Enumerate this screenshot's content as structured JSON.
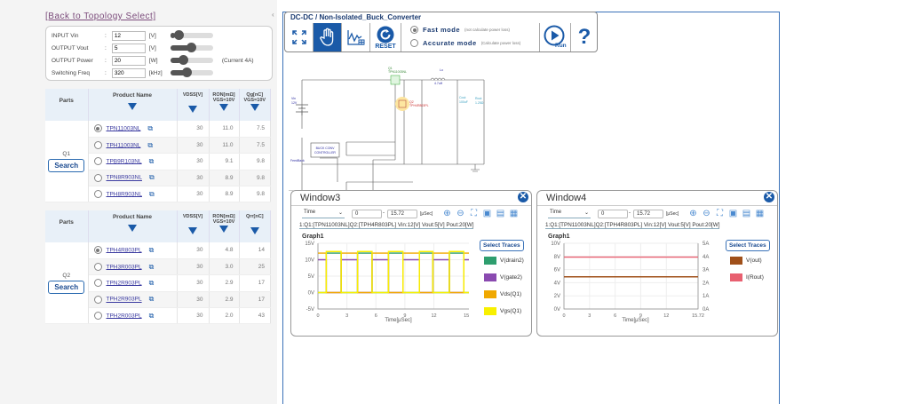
{
  "back_link": "[Back to Topology Select]",
  "params": [
    {
      "label": "INPUT Vin",
      "value": "12",
      "unit": "[V]",
      "slider": 0.1,
      "note": ""
    },
    {
      "label": "OUTPUT Vout",
      "value": "5",
      "unit": "[V]",
      "slider": 0.5,
      "note": ""
    },
    {
      "label": "OUTPUT Power",
      "value": "20",
      "unit": "[W]",
      "slider": 0.25,
      "note": "(Current 4A)"
    },
    {
      "label": "Switching Freq",
      "value": "320",
      "unit": "[kHz]",
      "slider": 0.35,
      "note": ""
    }
  ],
  "table_headers": {
    "parts": "Parts",
    "product": "Product Name",
    "vdss": "VDSS[V]",
    "ron": "RON[mΩ]",
    "ron_sub": "VGS=10V",
    "qg": "Qg[nC]",
    "qg_sub": "VGS=10V",
    "qrr": "Qrr[nC]"
  },
  "q1": {
    "label": "Q1",
    "search": "Search",
    "rows": [
      {
        "name": "TPN11003NL",
        "vdss": "30",
        "ron": "11.0",
        "q": "7.5",
        "selected": true
      },
      {
        "name": "TPH11003NL",
        "vdss": "30",
        "ron": "11.0",
        "q": "7.5",
        "selected": false
      },
      {
        "name": "TPB9R103NL",
        "vdss": "30",
        "ron": "9.1",
        "q": "9.8",
        "selected": false
      },
      {
        "name": "TPN8R903NL",
        "vdss": "30",
        "ron": "8.9",
        "q": "9.8",
        "selected": false
      },
      {
        "name": "TPH8R903NL",
        "vdss": "30",
        "ron": "8.9",
        "q": "9.8",
        "selected": false
      }
    ]
  },
  "q2": {
    "label": "Q2",
    "search": "Search",
    "rows": [
      {
        "name": "TPH4R803PL",
        "vdss": "30",
        "ron": "4.8",
        "q": "14",
        "selected": true
      },
      {
        "name": "TPH3R003PL",
        "vdss": "30",
        "ron": "3.0",
        "q": "25",
        "selected": false
      },
      {
        "name": "TPN2R903PL",
        "vdss": "30",
        "ron": "2.9",
        "q": "17",
        "selected": false
      },
      {
        "name": "TPH2R903PL",
        "vdss": "30",
        "ron": "2.9",
        "q": "17",
        "selected": false
      },
      {
        "name": "TPH2R003PL",
        "vdss": "30",
        "ron": "2.0",
        "q": "43",
        "selected": false
      }
    ]
  },
  "toolbar": {
    "title": "DC-DC / Non-Isolated_Buck_Converter",
    "reset": "RESET",
    "run": "Run",
    "help": "?",
    "fast_mode": "Fast mode",
    "fast_note": "(not calculate power loss)",
    "accurate_mode": "Accurate mode",
    "accurate_note": "(Calculate power loss)",
    "selected_mode": "fast"
  },
  "schematic": {
    "q1": "Q1",
    "q1_part": "TPN11003NL",
    "q2": "Q2",
    "q2_part": "TPH4R803PL",
    "lo": "Lo",
    "lo_val": "4.7uH",
    "cout": "Cout",
    "cout_val": "100uF",
    "rout": "Rout",
    "rout_val": "1.25Ω",
    "vin": "Vin",
    "vin_val": "12V",
    "ctrl1": "BUCK CONV",
    "ctrl2": "CONTROLLER",
    "fb": "FeedBack"
  },
  "windows": [
    {
      "title": "Window3",
      "axis": "Time",
      "from": "0",
      "to": "15.72",
      "unit": "[μSec]",
      "info": "1:Q1:[TPN11003NL]Q2:[TPH4R803PL] Vin:12[V]  Vout:5[V]  Pout:20[W]",
      "graph": "Graph1",
      "select": "Select Traces"
    },
    {
      "title": "Window4",
      "axis": "Time",
      "from": "0",
      "to": "15.72",
      "unit": "[μSec]",
      "info": "1:Q1:[TPN11003NL]Q2:[TPH4R803PL] Vin:12[V]  Vout:5[V]  Pout:20[W]",
      "graph": "Graph1",
      "select": "Select Traces"
    }
  ],
  "chart_data": [
    {
      "type": "line",
      "title": "Graph1",
      "xlabel": "Time[μSec]",
      "xlim": [
        0,
        15.72
      ],
      "xticks": [
        "0",
        "3",
        "6",
        "9",
        "12",
        "15.72"
      ],
      "ylim": [
        -5,
        15
      ],
      "yticks": [
        "15V",
        "10V",
        "5V",
        "0V",
        "-5V"
      ],
      "legend": "right",
      "series": [
        {
          "name": "V(drain2)",
          "color": "#2e9e6e",
          "high": 12,
          "low": 0,
          "high_intervals": [
            [
              0.86,
              2.4
            ],
            [
              4.1,
              5.6
            ],
            [
              7.3,
              8.8
            ],
            [
              10.5,
              11.9
            ],
            [
              13.6,
              15.1
            ]
          ]
        },
        {
          "name": "V(gate2)",
          "color": "#8a4ab0",
          "high": 10,
          "low": 0,
          "high_intervals": [
            [
              0,
              0.86
            ],
            [
              2.4,
              4.1
            ],
            [
              5.6,
              7.3
            ],
            [
              8.8,
              10.5
            ],
            [
              11.9,
              13.6
            ],
            [
              15.1,
              15.72
            ]
          ]
        },
        {
          "name": "Vds(Q1)",
          "color": "#f0a800",
          "high": 12,
          "low": 0,
          "high_intervals": [
            [
              0,
              0.86
            ],
            [
              2.4,
              4.1
            ],
            [
              5.6,
              7.3
            ],
            [
              8.8,
              10.5
            ],
            [
              11.9,
              13.6
            ],
            [
              15.1,
              15.72
            ]
          ]
        },
        {
          "name": "Vgs(Q1)",
          "color": "#f8f000",
          "high": 12.5,
          "low": 0,
          "high_intervals": [
            [
              0.86,
              2.4
            ],
            [
              4.1,
              5.6
            ],
            [
              7.3,
              8.8
            ],
            [
              10.5,
              11.9
            ],
            [
              13.6,
              15.1
            ]
          ]
        }
      ]
    },
    {
      "type": "line",
      "title": "Graph1",
      "xlabel": "Time[μSec]",
      "xlim": [
        0,
        15.72
      ],
      "xticks": [
        "0",
        "3",
        "6",
        "9",
        "12",
        "15.72"
      ],
      "ylim": [
        0,
        10
      ],
      "yticks": [
        "10V",
        "8V",
        "6V",
        "4V",
        "2V",
        "0V"
      ],
      "y2lim": [
        0,
        5
      ],
      "y2ticks": [
        "5A",
        "4A",
        "3A",
        "2A",
        "1A",
        "0A"
      ],
      "legend": "right",
      "series": [
        {
          "name": "V(out)",
          "color": "#a0501a",
          "axis": "left",
          "value": 4.9
        },
        {
          "name": "I(Rout)",
          "color": "#e86070",
          "axis": "right",
          "value": 3.95
        }
      ]
    }
  ]
}
